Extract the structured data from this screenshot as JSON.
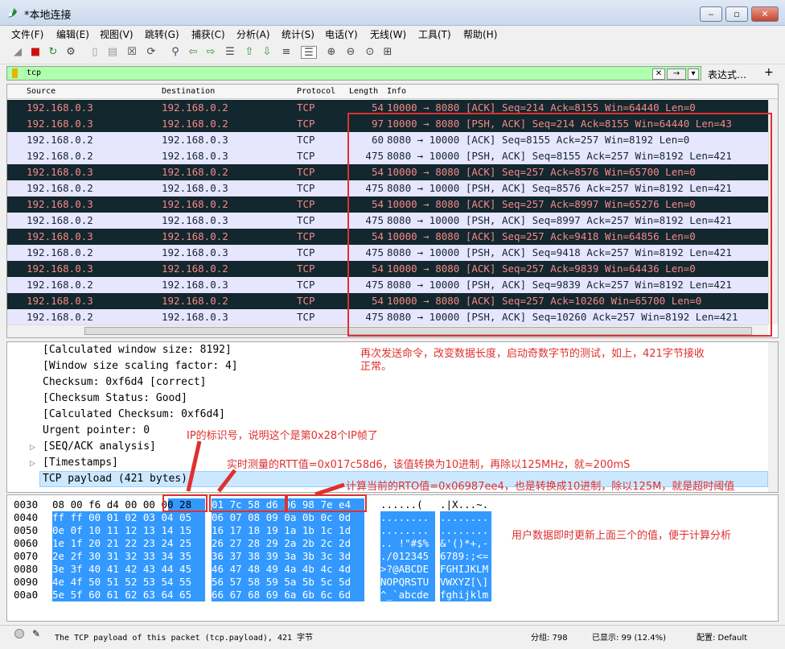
{
  "window": {
    "title": "*本地连接"
  },
  "menu": [
    "文件(F)",
    "编辑(E)",
    "视图(V)",
    "跳转(G)",
    "捕获(C)",
    "分析(A)",
    "统计(S)",
    "电话(Y)",
    "无线(W)",
    "工具(T)",
    "帮助(H)"
  ],
  "filter": {
    "value": "tcp",
    "expression_label": "表达式…",
    "plus": "+"
  },
  "columns": {
    "source": "Source",
    "destination": "Destination",
    "protocol": "Protocol",
    "length": "Length",
    "info": "Info"
  },
  "packets": [
    {
      "src": "192.168.0.3",
      "dst": "192.168.0.2",
      "proto": "TCP",
      "len": "54",
      "info": "10000 → 8080 [ACK] Seq=214 Ack=8155 Win=64440 Len=0",
      "style": "dark"
    },
    {
      "src": "192.168.0.3",
      "dst": "192.168.0.2",
      "proto": "TCP",
      "len": "97",
      "info": "10000 → 8080 [PSH, ACK] Seq=214 Ack=8155 Win=64440 Len=43",
      "style": "dark"
    },
    {
      "src": "192.168.0.2",
      "dst": "192.168.0.3",
      "proto": "TCP",
      "len": "60",
      "info": "8080 → 10000 [ACK] Seq=8155 Ack=257 Win=8192 Len=0",
      "style": "light"
    },
    {
      "src": "192.168.0.2",
      "dst": "192.168.0.3",
      "proto": "TCP",
      "len": "475",
      "info": "8080 → 10000 [PSH, ACK] Seq=8155 Ack=257 Win=8192 Len=421",
      "style": "light"
    },
    {
      "src": "192.168.0.3",
      "dst": "192.168.0.2",
      "proto": "TCP",
      "len": "54",
      "info": "10000 → 8080 [ACK] Seq=257 Ack=8576 Win=65700 Len=0",
      "style": "dark"
    },
    {
      "src": "192.168.0.2",
      "dst": "192.168.0.3",
      "proto": "TCP",
      "len": "475",
      "info": "8080 → 10000 [PSH, ACK] Seq=8576 Ack=257 Win=8192 Len=421",
      "style": "light"
    },
    {
      "src": "192.168.0.3",
      "dst": "192.168.0.2",
      "proto": "TCP",
      "len": "54",
      "info": "10000 → 8080 [ACK] Seq=257 Ack=8997 Win=65276 Len=0",
      "style": "dark"
    },
    {
      "src": "192.168.0.2",
      "dst": "192.168.0.3",
      "proto": "TCP",
      "len": "475",
      "info": "8080 → 10000 [PSH, ACK] Seq=8997 Ack=257 Win=8192 Len=421",
      "style": "light"
    },
    {
      "src": "192.168.0.3",
      "dst": "192.168.0.2",
      "proto": "TCP",
      "len": "54",
      "info": "10000 → 8080 [ACK] Seq=257 Ack=9418 Win=64856 Len=0",
      "style": "dark"
    },
    {
      "src": "192.168.0.2",
      "dst": "192.168.0.3",
      "proto": "TCP",
      "len": "475",
      "info": "8080 → 10000 [PSH, ACK] Seq=9418 Ack=257 Win=8192 Len=421",
      "style": "light"
    },
    {
      "src": "192.168.0.3",
      "dst": "192.168.0.2",
      "proto": "TCP",
      "len": "54",
      "info": "10000 → 8080 [ACK] Seq=257 Ack=9839 Win=64436 Len=0",
      "style": "dark"
    },
    {
      "src": "192.168.0.2",
      "dst": "192.168.0.3",
      "proto": "TCP",
      "len": "475",
      "info": "8080 → 10000 [PSH, ACK] Seq=9839 Ack=257 Win=8192 Len=421",
      "style": "light"
    },
    {
      "src": "192.168.0.3",
      "dst": "192.168.0.2",
      "proto": "TCP",
      "len": "54",
      "info": "10000 → 8080 [ACK] Seq=257 Ack=10260 Win=65700 Len=0",
      "style": "dark"
    },
    {
      "src": "192.168.0.2",
      "dst": "192.168.0.3",
      "proto": "TCP",
      "len": "475",
      "info": "8080 → 10000 [PSH, ACK] Seq=10260 Ack=257 Win=8192 Len=421",
      "style": "light"
    }
  ],
  "details": [
    {
      "text": "[Calculated window size: 8192]",
      "expandable": false
    },
    {
      "text": "[Window size scaling factor: 4]",
      "expandable": false
    },
    {
      "text": "Checksum: 0xf6d4 [correct]",
      "expandable": false
    },
    {
      "text": "[Checksum Status: Good]",
      "expandable": false
    },
    {
      "text": "[Calculated Checksum: 0xf6d4]",
      "expandable": false
    },
    {
      "text": "Urgent pointer: 0",
      "expandable": false
    },
    {
      "text": "[SEQ/ACK analysis]",
      "expandable": true
    },
    {
      "text": "[Timestamps]",
      "expandable": true
    },
    {
      "text": "TCP payload (421 bytes)",
      "expandable": false,
      "selected": true
    }
  ],
  "bytes": [
    {
      "off": "0030",
      "h1": "08 00 f6 d4 00 00 00 28",
      "h2": "01 7c 58 d6 06 98 7e e4",
      "a1": "......(",
      "a2": ".|X...~."
    },
    {
      "off": "0040",
      "h1": "ff ff 00 01 02 03 04 05",
      "h2": "06 07 08 09 0a 0b 0c 0d",
      "a1": "........",
      "a2": "........"
    },
    {
      "off": "0050",
      "h1": "0e 0f 10 11 12 13 14 15",
      "h2": "16 17 18 19 1a 1b 1c 1d",
      "a1": "........",
      "a2": "........"
    },
    {
      "off": "0060",
      "h1": "1e 1f 20 21 22 23 24 25",
      "h2": "26 27 28 29 2a 2b 2c 2d",
      "a1": ".. !\"#$%",
      "a2": "&'()*+,-"
    },
    {
      "off": "0070",
      "h1": "2e 2f 30 31 32 33 34 35",
      "h2": "36 37 38 39 3a 3b 3c 3d",
      "a1": "./012345",
      "a2": "6789:;<="
    },
    {
      "off": "0080",
      "h1": "3e 3f 40 41 42 43 44 45",
      "h2": "46 47 48 49 4a 4b 4c 4d",
      "a1": ">?@ABCDE",
      "a2": "FGHIJKLM"
    },
    {
      "off": "0090",
      "h1": "4e 4f 50 51 52 53 54 55",
      "h2": "56 57 58 59 5a 5b 5c 5d",
      "a1": "NOPQRSTU",
      "a2": "VWXYZ[\\]"
    },
    {
      "off": "00a0",
      "h1": "5e 5f 60 61 62 63 64 65",
      "h2": "66 67 68 69 6a 6b 6c 6d",
      "a1": "^_`abcde",
      "a2": "fghijklm"
    }
  ],
  "annotations": {
    "a1": "再次发送命令，改变数据长度，启动奇数字节的测试，如上，421字节接收",
    "a1b": "正常。",
    "a2": "IP的标识号，说明这个是第0x28个IP帧了",
    "a3": "实时测量的RTT值=0x017c58d6，该值转换为10进制，再除以125MHz，就≈200mS",
    "a4": "计算当前的RTO值=0x06987ee4，也是转换成10进制，除以125M，就是超时阈值",
    "a5": "用户数据即时更新上面三个的值，便于计算分析"
  },
  "status": {
    "field": "The TCP payload of this packet (tcp.payload), 421 字节",
    "packets": "分组: 798",
    "displayed": "已显示: 99 (12.4%)",
    "profile": "配置: Default"
  },
  "colors": {
    "dark_bg": "#12272e",
    "dark_fg": "#f78787",
    "light_bg": "#e7e6ff",
    "highlight": "#3399ff",
    "anno": "#e03030",
    "filter_ok": "#afffaf"
  }
}
